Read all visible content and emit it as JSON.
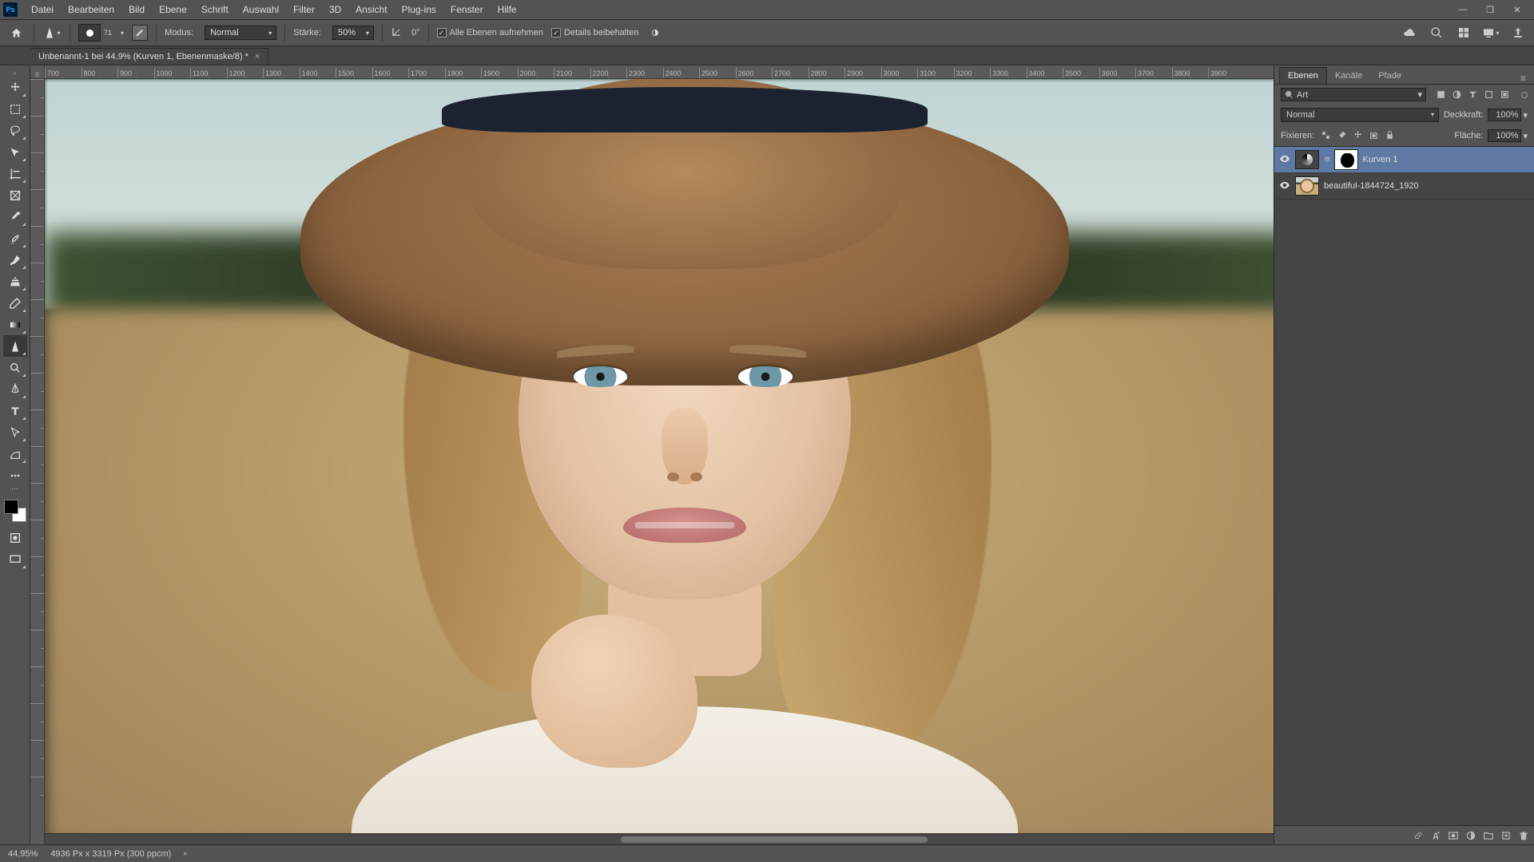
{
  "app_icon_text": "Ps",
  "menus": [
    "Datei",
    "Bearbeiten",
    "Bild",
    "Ebene",
    "Schrift",
    "Auswahl",
    "Filter",
    "3D",
    "Ansicht",
    "Plug-ins",
    "Fenster",
    "Hilfe"
  ],
  "options": {
    "brush_size_label": "71",
    "modus_label": "Modus:",
    "modus_value": "Normal",
    "staerke_label": "Stärke:",
    "staerke_value": "50%",
    "angle_value": "0°",
    "check1_label": "Alle Ebenen aufnehmen",
    "check2_label": "Details beibehalten"
  },
  "document_tab": "Unbenannt-1 bei 44,9% (Kurven 1, Ebenenmaske/8) *",
  "ruler_ticks": [
    "700",
    "800",
    "900",
    "1000",
    "1100",
    "1200",
    "1300",
    "1400",
    "1500",
    "1600",
    "1700",
    "1800",
    "1900",
    "2000",
    "2100",
    "2200",
    "2300",
    "2400",
    "2500",
    "2600",
    "2700",
    "2800",
    "2900",
    "3000",
    "3100",
    "3200",
    "3300",
    "3400",
    "3500",
    "3600",
    "3700",
    "3800",
    "3900"
  ],
  "ruler_origin": "0",
  "panel": {
    "tabs": {
      "layers": "Ebenen",
      "channels": "Kanäle",
      "paths": "Pfade"
    },
    "search_value": "Art",
    "blend_mode": "Normal",
    "opacity_label": "Deckkraft:",
    "opacity_value": "100%",
    "lock_label": "Fixieren:",
    "fill_label": "Fläche:",
    "fill_value": "100%",
    "layers": [
      {
        "name": "Kurven 1"
      },
      {
        "name": "beautiful-1844724_1920"
      }
    ]
  },
  "status": {
    "zoom": "44,95%",
    "doc_info": "4936 Px x 3319 Px (300 ppcm)"
  }
}
